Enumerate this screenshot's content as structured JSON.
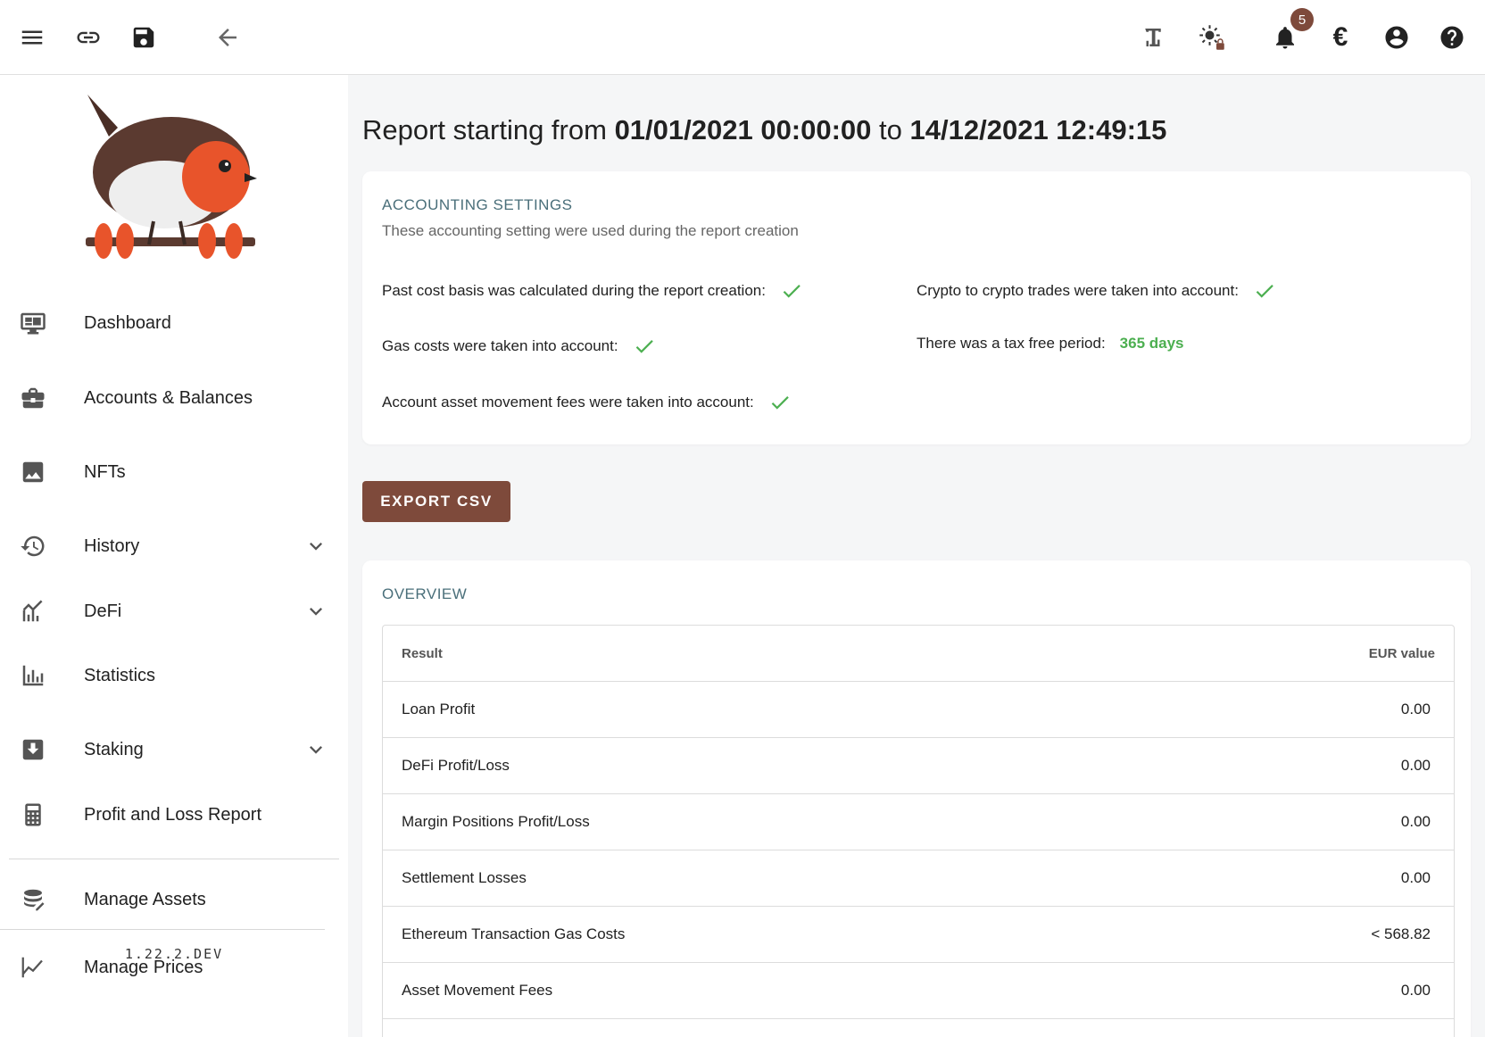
{
  "topbar": {
    "notifications_count": "5",
    "currency_symbol": "€"
  },
  "sidebar": {
    "items": [
      {
        "label": "Dashboard",
        "icon": "dashboard-icon"
      },
      {
        "label": "Accounts & Balances",
        "icon": "briefcase-icon"
      },
      {
        "label": "NFTs",
        "icon": "image-icon"
      },
      {
        "label": "History",
        "icon": "history-icon",
        "expandable": true
      },
      {
        "label": "DeFi",
        "icon": "chart-line-icon",
        "expandable": true
      },
      {
        "label": "Statistics",
        "icon": "bar-chart-icon"
      },
      {
        "label": "Staking",
        "icon": "inbox-download-icon",
        "expandable": true
      },
      {
        "label": "Profit and Loss Report",
        "icon": "calculator-icon"
      },
      {
        "label": "Manage Assets",
        "icon": "database-edit-icon"
      },
      {
        "label": "Manage Prices",
        "icon": "chart-line-variant-icon"
      }
    ],
    "version": "1.22.2.DEV"
  },
  "report": {
    "title_prefix": "Report starting from",
    "start": "01/01/2021 00:00:00",
    "title_mid": "to",
    "end": "14/12/2021 12:49:15"
  },
  "accounting": {
    "title": "ACCOUNTING SETTINGS",
    "subtitle": "These accounting setting were used during the report creation",
    "past_cost_basis": "Past cost basis was calculated during the report creation:",
    "crypto_to_crypto": "Crypto to crypto trades were taken into account:",
    "gas_costs": "Gas costs were taken into account:",
    "tax_free_period": "There was a tax free period:",
    "tax_free_value": "365 days",
    "movement_fees": "Account asset movement fees were taken into account:"
  },
  "export_button": "EXPORT CSV",
  "overview": {
    "title": "OVERVIEW",
    "headers": {
      "result": "Result",
      "value": "EUR value"
    },
    "rows": [
      {
        "label": "Loan Profit",
        "value": "0.00"
      },
      {
        "label": "DeFi Profit/Loss",
        "value": "0.00"
      },
      {
        "label": "Margin Positions Profit/Loss",
        "value": "0.00"
      },
      {
        "label": "Settlement Losses",
        "value": "0.00"
      },
      {
        "label": "Ethereum Transaction Gas Costs",
        "value": "< 568.82"
      },
      {
        "label": "Asset Movement Fees",
        "value": "0.00"
      }
    ]
  },
  "colors": {
    "brand": "#7e4a3b",
    "accent_title": "#4a6f7a",
    "success": "#4caf50"
  }
}
